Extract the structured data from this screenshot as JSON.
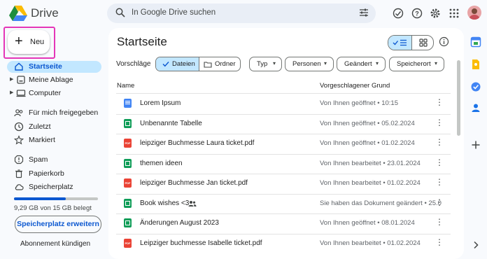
{
  "app": {
    "name": "Drive"
  },
  "search": {
    "placeholder": "In Google Drive suchen"
  },
  "new_button": {
    "label": "Neu"
  },
  "sidebar": {
    "items": [
      {
        "label": "Startseite",
        "icon": "home-icon",
        "active": true
      },
      {
        "label": "Meine Ablage",
        "icon": "my-drive-icon",
        "expandable": true
      },
      {
        "label": "Computer",
        "icon": "computer-icon",
        "expandable": true
      },
      {
        "label": "Für mich freigegeben",
        "icon": "shared-icon"
      },
      {
        "label": "Zuletzt",
        "icon": "clock-icon"
      },
      {
        "label": "Markiert",
        "icon": "star-icon"
      },
      {
        "label": "Spam",
        "icon": "spam-icon"
      },
      {
        "label": "Papierkorb",
        "icon": "trash-icon"
      },
      {
        "label": "Speicherplatz",
        "icon": "cloud-icon"
      }
    ],
    "storage_used_fraction": 0.62,
    "storage_text": "9,29 GB von 15 GB belegt",
    "upgrade_label": "Speicherplatz erweitern",
    "cancel_label": "Abonnement kündigen"
  },
  "main": {
    "title": "Startseite",
    "suggestions_label": "Vorschläge",
    "toggle": {
      "files": "Dateien",
      "folders": "Ordner"
    },
    "filters": [
      "Typ",
      "Personen",
      "Geändert",
      "Speicherort"
    ],
    "columns": {
      "name": "Name",
      "reason": "Vorgeschlagener Grund"
    },
    "files": [
      {
        "name": "Lorem Ipsum",
        "type": "doc",
        "reason": "Von Ihnen geöffnet • 10:15"
      },
      {
        "name": "Unbenannte Tabelle",
        "type": "sheet",
        "reason": "Von Ihnen geöffnet • 05.02.2024"
      },
      {
        "name": "leipziger Buchmesse Laura ticket.pdf",
        "type": "pdf",
        "reason": "Von Ihnen geöffnet • 01.02.2024"
      },
      {
        "name": "themen ideen",
        "type": "sheet",
        "reason": "Von Ihnen bearbeitet • 23.01.2024"
      },
      {
        "name": "leipziger Buchmesse Jan ticket.pdf",
        "type": "pdf",
        "reason": "Von Ihnen bearbeitet • 01.02.2024"
      },
      {
        "name": "Book wishes <3",
        "type": "sheet",
        "shared": true,
        "reason": "Sie haben das Dokument geändert • 25.0"
      },
      {
        "name": "Änderungen August 2023",
        "type": "sheet",
        "reason": "Von Ihnen geöffnet • 08.01.2024"
      },
      {
        "name": "Leipziger buchmesse Isabelle ticket.pdf",
        "type": "pdf",
        "reason": "Von Ihnen bearbeitet • 01.02.2024"
      }
    ]
  },
  "colors": {
    "accent": "#0b57d0",
    "active_bg": "#c2e7ff",
    "highlight_border": "#e436b8"
  }
}
